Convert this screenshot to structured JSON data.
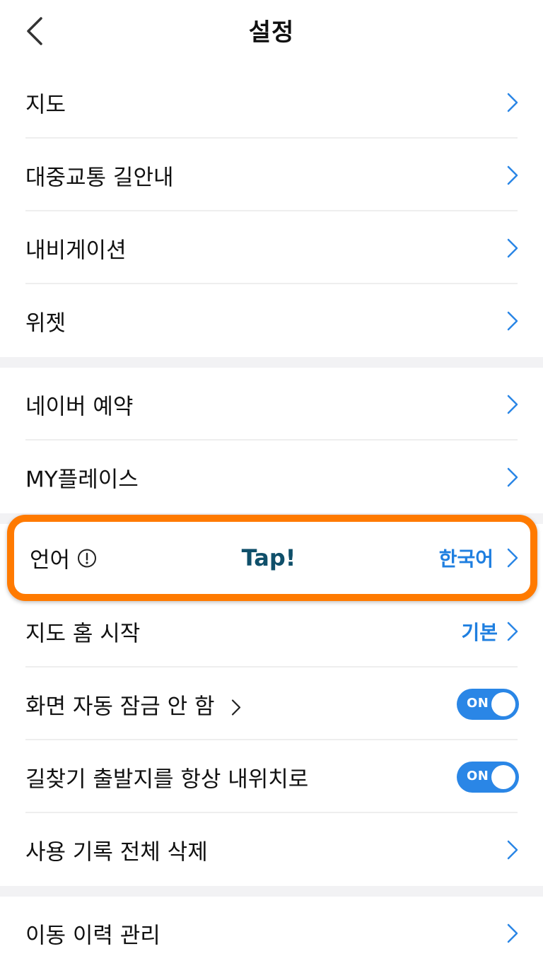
{
  "header": {
    "title": "설정",
    "back_icon": "chevron-left-icon"
  },
  "section1": {
    "items": [
      {
        "label": "지도"
      },
      {
        "label": "대중교통 길안내"
      },
      {
        "label": "내비게이션"
      },
      {
        "label": "위젯"
      }
    ]
  },
  "section2": {
    "items": [
      {
        "label": "네이버 예약"
      },
      {
        "label": "MY플레이스"
      }
    ]
  },
  "section3": {
    "language": {
      "label": "언어",
      "hint": "Tap!",
      "value": "한국어",
      "info_icon": "info-circle-icon",
      "highlight_color": "#ff7a00"
    },
    "map_home_start": {
      "label": "지도 홈 시작",
      "value": "기본"
    },
    "screen_lock": {
      "label": "화면 자동 잠금 안 함",
      "toggle": "ON"
    },
    "route_origin": {
      "label": "길찾기 출발지를 항상 내위치로",
      "toggle": "ON"
    },
    "delete_history": {
      "label": "사용 기록 전체 삭제"
    }
  },
  "section4": {
    "items": [
      {
        "label": "이동 이력 관리"
      }
    ]
  },
  "colors": {
    "accent": "#1f7fe0",
    "toggle_on": "#2a86e6",
    "section_gap": "#f2f2f4",
    "highlight": "#ff7a00"
  }
}
